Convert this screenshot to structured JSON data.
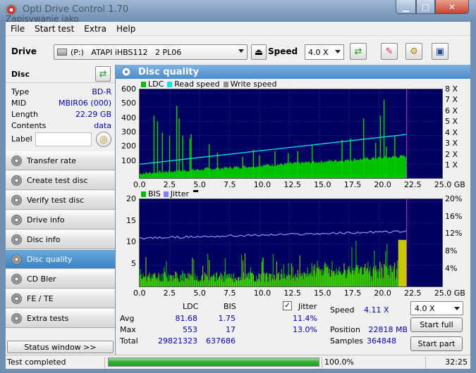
{
  "window": {
    "title": "Opti Drive Control 1.70",
    "ghost_text": "Zapisywanie jako"
  },
  "menu": [
    "File",
    "Start test",
    "Extra",
    "Help"
  ],
  "toolbar": {
    "drive_label": "Drive",
    "drive_value": "(P:)   ATAPI iHBS112   2 PL06",
    "speed_label": "Speed",
    "speed_value": "4.0 X"
  },
  "disc": {
    "heading": "Disc",
    "rows": [
      {
        "k": "Type",
        "v": "BD-R"
      },
      {
        "k": "MID",
        "v": "MBIR06 (000)"
      },
      {
        "k": "Length",
        "v": "22.29 GB"
      },
      {
        "k": "Contents",
        "v": "data"
      }
    ],
    "label_key": "Label"
  },
  "nav": [
    "Transfer rate",
    "Create test disc",
    "Verify test disc",
    "Drive info",
    "Disc info",
    "Disc quality",
    "CD Bler",
    "FE / TE",
    "Extra tests"
  ],
  "nav_active": 5,
  "status_window": "Status window >>",
  "panel_title": "Disc quality",
  "top_chart": {
    "legend": [
      {
        "name": "LDC",
        "color": "#00c000"
      },
      {
        "name": "Read speed",
        "color": "#00e8e8"
      },
      {
        "name": "Write speed",
        "color": "#909090"
      }
    ],
    "y_ticks": [
      "600",
      "500",
      "400",
      "300",
      "200",
      "100"
    ],
    "y2_ticks": [
      "8 X",
      "7 X",
      "6 X",
      "5 X",
      "4 X",
      "3 X",
      "2 X",
      "1 X"
    ],
    "x_ticks": [
      "0.0",
      "2.5",
      "5.0",
      "7.5",
      "10.0",
      "12.5",
      "15.0",
      "17.5",
      "20.0",
      "22.5",
      "25.0 GB"
    ]
  },
  "bottom_chart": {
    "legend": [
      {
        "name": "BIS",
        "color": "#00c000"
      },
      {
        "name": "Jitter",
        "color": "#8080ff"
      }
    ],
    "y_ticks": [
      "20",
      "15",
      "10",
      "5"
    ],
    "y2_ticks": [
      "20%",
      "16%",
      "12%",
      "8%",
      "4%"
    ],
    "x_ticks": [
      "0.0",
      "2.5",
      "5.0",
      "7.5",
      "10.0",
      "12.5",
      "15.0",
      "17.5",
      "20.0",
      "22.5",
      "25.0 GB"
    ]
  },
  "chart_data": [
    {
      "type": "bar",
      "title": "",
      "series": [
        {
          "name": "LDC",
          "approx_avg": 81.68,
          "approx_max": 553
        },
        {
          "name": "Read speed",
          "start_x": 1.3,
          "end_x": 4.1
        }
      ],
      "xlim": [
        0,
        25
      ],
      "ylim": [
        0,
        600
      ],
      "y2lim": [
        0,
        8
      ],
      "xlabel": "GB",
      "ylabel": "",
      "disc_end_gb": 22.29
    },
    {
      "type": "bar",
      "title": "",
      "series": [
        {
          "name": "BIS",
          "approx_avg": 1.75,
          "approx_max": 17
        },
        {
          "name": "Jitter",
          "start": 11.4,
          "end": 13.0
        }
      ],
      "xlim": [
        0,
        25
      ],
      "ylim": [
        0,
        20
      ],
      "y2lim": [
        0,
        20
      ],
      "xlabel": "GB",
      "ylabel": ""
    }
  ],
  "stats": {
    "headers": {
      "ldc": "LDC",
      "bis": "BIS",
      "jitter": "Jitter"
    },
    "rows": [
      {
        "k": "Avg",
        "ldc": "81.68",
        "bis": "1.75",
        "jitter": "11.4%"
      },
      {
        "k": "Max",
        "ldc": "553",
        "bis": "17",
        "jitter": "13.0%"
      },
      {
        "k": "Total",
        "ldc": "29821323",
        "bis": "637686",
        "jitter": ""
      }
    ],
    "speed_label": "Speed",
    "speed_value": "4.11 X",
    "position_label": "Position",
    "position_value": "22818 MB",
    "samples_label": "Samples",
    "samples_value": "364848",
    "speed_select": "4.0 X",
    "start_full": "Start full",
    "start_part": "Start part"
  },
  "status": {
    "text": "Test completed",
    "progress": 1.0,
    "percent": "100.0%",
    "time": "32:25"
  }
}
